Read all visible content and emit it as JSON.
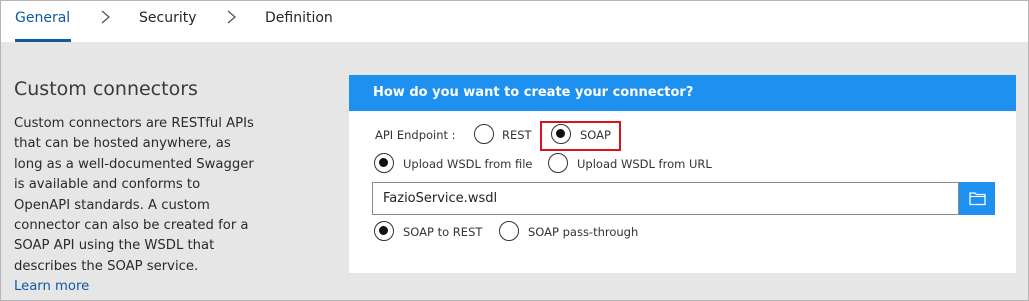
{
  "tabs": [
    {
      "label": "General",
      "active": true
    },
    {
      "label": "Security",
      "active": false
    },
    {
      "label": "Definition",
      "active": false
    }
  ],
  "left_panel": {
    "title": "Custom connectors",
    "description": "Custom connectors are RESTful APIs that can be hosted anywhere, as long as a well-documented Swagger is available and conforms to OpenAPI standards. A custom connector can also be created for a SOAP API using the WSDL that describes the SOAP service.",
    "link": "Learn more"
  },
  "card": {
    "header": "How do you want to create your connector?",
    "api_endpoint_label": "API Endpoint :",
    "endpoint_options": [
      {
        "label": "REST",
        "checked": false
      },
      {
        "label": "SOAP",
        "checked": true
      }
    ],
    "wsdl_options": [
      {
        "label": "Upload WSDL from file",
        "checked": true
      },
      {
        "label": "Upload WSDL from URL",
        "checked": false
      }
    ],
    "file_value": "FazioService.wsdl",
    "browse_icon": "folder-icon",
    "mode_options": [
      {
        "label": "SOAP to REST",
        "checked": true
      },
      {
        "label": "SOAP pass-through",
        "checked": false
      }
    ]
  },
  "colors": {
    "accent": "#1e90f0",
    "tab_active": "#0f5aa3",
    "highlight": "#d8141b",
    "background": "#e6e6e6"
  }
}
